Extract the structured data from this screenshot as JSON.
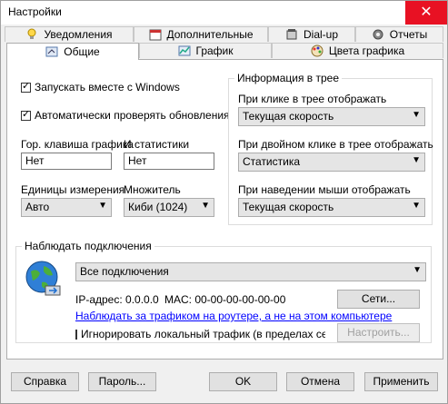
{
  "window": {
    "title": "Настройки",
    "close_glyph": "✕"
  },
  "tabs_back": [
    {
      "label": "Уведомления",
      "icon": "bulb-icon"
    },
    {
      "label": "Дополнительные",
      "icon": "calendar-icon"
    },
    {
      "label": "Dial-up",
      "icon": "phone-icon"
    },
    {
      "label": "Отчеты",
      "icon": "gear-icon"
    }
  ],
  "tabs_front": [
    {
      "label": "Общие",
      "icon": "wrench-icon",
      "active": true
    },
    {
      "label": "График",
      "icon": "chart-icon"
    },
    {
      "label": "Цвета графика",
      "icon": "palette-icon"
    }
  ],
  "general": {
    "start_with_windows": "Запускать вместе с Windows",
    "auto_update": "Автоматически проверять обновления",
    "hotkey_graph_label": "Гор. клавиша графика",
    "hotkey_stats_label": "И статистики",
    "hotkey_graph_value": "Нет",
    "hotkey_stats_value": "Нет",
    "units_label": "Единицы измерения",
    "units_value": "Авто",
    "multiplier_label": "Множитель",
    "multiplier_value": "Киби (1024)"
  },
  "tray": {
    "group_title": "Информация в трее",
    "click_label": "При клике в трее отображать",
    "click_value": "Текущая скорость",
    "dblclick_label": "При двойном клике в трее отображать",
    "dblclick_value": "Статистика",
    "hover_label": "При наведении мыши отображать",
    "hover_value": "Текущая скорость"
  },
  "monitor": {
    "group_title": "Наблюдать подключения",
    "connection_value": "Все подключения",
    "ip_text": "IP-адрес: 0.0.0.0",
    "mac_text": "MAC: 00-00-00-00-00-00",
    "networks_button": "Сети...",
    "router_link": "Наблюдать за трафиком на роутере, а не на этом компьютере",
    "ignore_local": "Игнорировать локальный трафик (в пределах сети)",
    "configure_button": "Настроить..."
  },
  "footer": {
    "help": "Справка",
    "password": "Пароль...",
    "ok": "OK",
    "cancel": "Отмена",
    "apply": "Применить"
  }
}
